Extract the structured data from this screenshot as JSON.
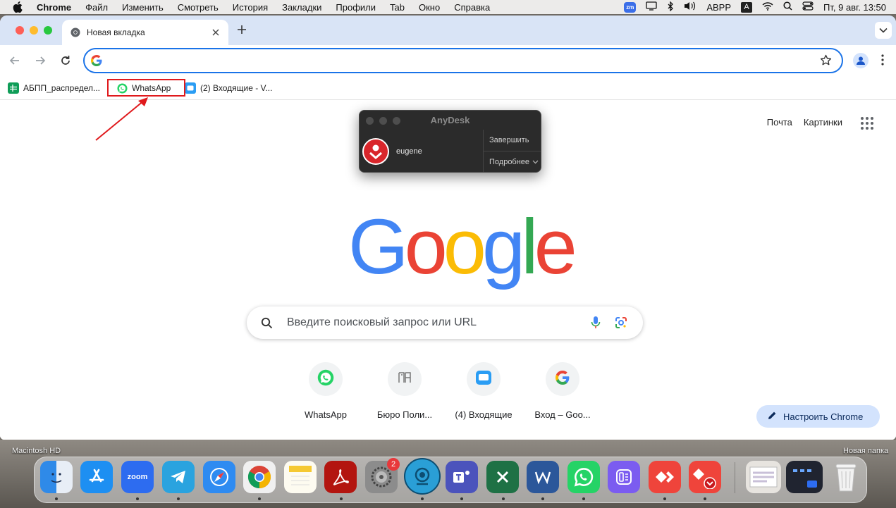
{
  "menubar": {
    "app_name": "Chrome",
    "items": [
      "Файл",
      "Изменить",
      "Смотреть",
      "История",
      "Закладки",
      "Профили",
      "Tab",
      "Окно",
      "Справка"
    ],
    "status": {
      "zoom_badge": "zm",
      "keyboard_layout": "ABPP",
      "input_badge": "A",
      "datetime": "Пт, 9 авг.  13:50"
    }
  },
  "browser": {
    "tab": {
      "title": "Новая вкладка"
    },
    "omnibox": {
      "value": ""
    },
    "bookmarks": [
      {
        "label": "АБПП_распредел...",
        "icon": "sheets-icon"
      },
      {
        "label": "WhatsApp",
        "icon": "whatsapp-icon"
      },
      {
        "label": "(2) Входящие - V...",
        "icon": "mail-icon"
      }
    ]
  },
  "newtab": {
    "top_links": [
      "Почта",
      "Картинки"
    ],
    "logo_letters": [
      "G",
      "o",
      "o",
      "g",
      "l",
      "e"
    ],
    "logo_colors": [
      "#4285F4",
      "#EA4335",
      "#FBBC05",
      "#4285F4",
      "#34A853",
      "#EA4335"
    ],
    "search_placeholder": "Введите поисковый запрос или URL",
    "shortcuts": [
      {
        "label": "WhatsApp",
        "icon": "whatsapp-icon"
      },
      {
        "label": "Бюро Поли...",
        "icon": "bureau-icon"
      },
      {
        "label": "(4) Входящие",
        "icon": "mail-icon"
      },
      {
        "label": "Вход – Goo...",
        "icon": "google-icon"
      }
    ],
    "customize_label": "Настроить Chrome"
  },
  "anydesk": {
    "title": "AnyDesk",
    "user": "eugene",
    "end_button": "Завершить",
    "details_button": "Подробнее"
  },
  "desktop": {
    "left_label": "Macintosh HD",
    "right_label": "Новая папка",
    "dock_badge": "2",
    "zoom_label": "zoom"
  },
  "colors": {
    "accent": "#1a73e8",
    "highlight": "#e0191c",
    "anydesk_red": "#d9262b",
    "whatsapp_green": "#25D366"
  }
}
